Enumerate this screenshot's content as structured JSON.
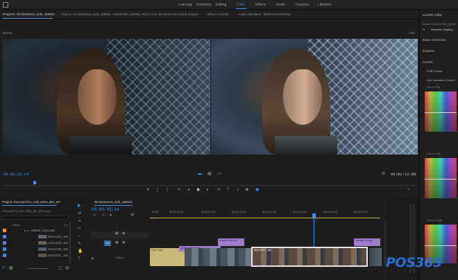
{
  "workspaces": [
    "Learning",
    "Assembly",
    "Editing",
    "Color",
    "Effects",
    "Audio",
    "Graphics",
    "Libraries"
  ],
  "active_workspace": "Color",
  "tabs": {
    "program": "Program: 00 Dreamers_Edit_180831",
    "source": "Source: 00 Dreamers_Edit_180831: A002C005_160508_R1LC.mov: 00:00:53:13",
    "scopes": "Lumetri Scopes",
    "effect_controls": "Effect Controls",
    "audio_mixer": "Audio Clip Mixer: SplitScreenPreview"
  },
  "monitor": {
    "before": "Before",
    "after": "After",
    "timecode": "00:00:05:14",
    "fit": "Fit",
    "full": "Full",
    "duration": "00:01:12:00"
  },
  "project": {
    "title": "Project: PremierePro_Fall_2018_IBC_EP",
    "file": "PremierePro_Fall_2018_IBC_EP.prproj",
    "col_name": "Name",
    "col_fr": "Fra",
    "folder": "160508_ICELAND",
    "items": [
      "A001C004_160",
      "A001C005_160",
      "A001C006_160",
      "A001C007_160"
    ]
  },
  "timeline": {
    "title": "00 Dreamers_Edit_180831",
    "timecode": "00:00:05:14",
    "ruler": [
      ":00:00",
      "00:00:01:00",
      "00:00:02:00",
      "00:00:03:00",
      "00:00:04:00",
      "00:00:05:00",
      "00:00:06:00",
      "00:00:07:00"
    ],
    "v1": "V1",
    "video1": "Video 1",
    "clips": [
      "Green Grey.mov",
      "Orange Orange",
      "Lens Flare",
      "SplitScreenPreview",
      "A001C007_160..."
    ]
  },
  "lumetri": {
    "title": "Lumetri Color",
    "master": "Master * A012C003_16050",
    "fx": "fx",
    "preset": "Selective Grading",
    "sections": [
      "Basic Correction",
      "Creative",
      "Curves",
      "RGB Curves",
      "Hue Saturation Curves"
    ],
    "curve_labels": [
      "Hue vs Sat",
      "Hue vs Hue",
      "Hue vs Luma"
    ]
  },
  "watermark": "POS365",
  "colors": {
    "accent": "#3b8ff5",
    "panel": "#1e1e1e",
    "clip_purple": "#a07ccd",
    "clip_yellow": "#c9b87a"
  },
  "icons": [
    "play-icon",
    "step-back-icon",
    "step-forward-icon",
    "marker-icon",
    "camera-icon",
    "wrench-icon",
    "selection-tool-icon",
    "razor-tool-icon",
    "hand-tool-icon",
    "text-tool-icon",
    "eye-icon",
    "lock-icon"
  ]
}
